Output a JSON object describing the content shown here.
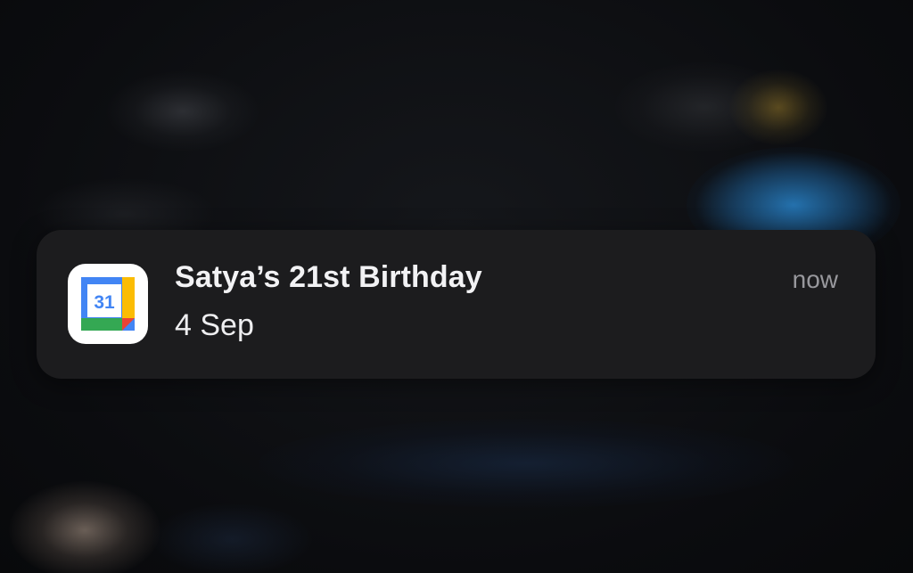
{
  "notification": {
    "app_icon": "google-calendar-icon",
    "icon_day_number": "31",
    "title": "Satya’s 21st Birthday",
    "body": "4 Sep",
    "time": "now"
  },
  "colors": {
    "card_background": "#1c1c1e",
    "title_text": "#f2f2f4",
    "time_text": "#98989d",
    "calendar_blue": "#4285f4",
    "calendar_green": "#34a853",
    "calendar_yellow": "#fbbc04",
    "calendar_red": "#ea4335"
  }
}
